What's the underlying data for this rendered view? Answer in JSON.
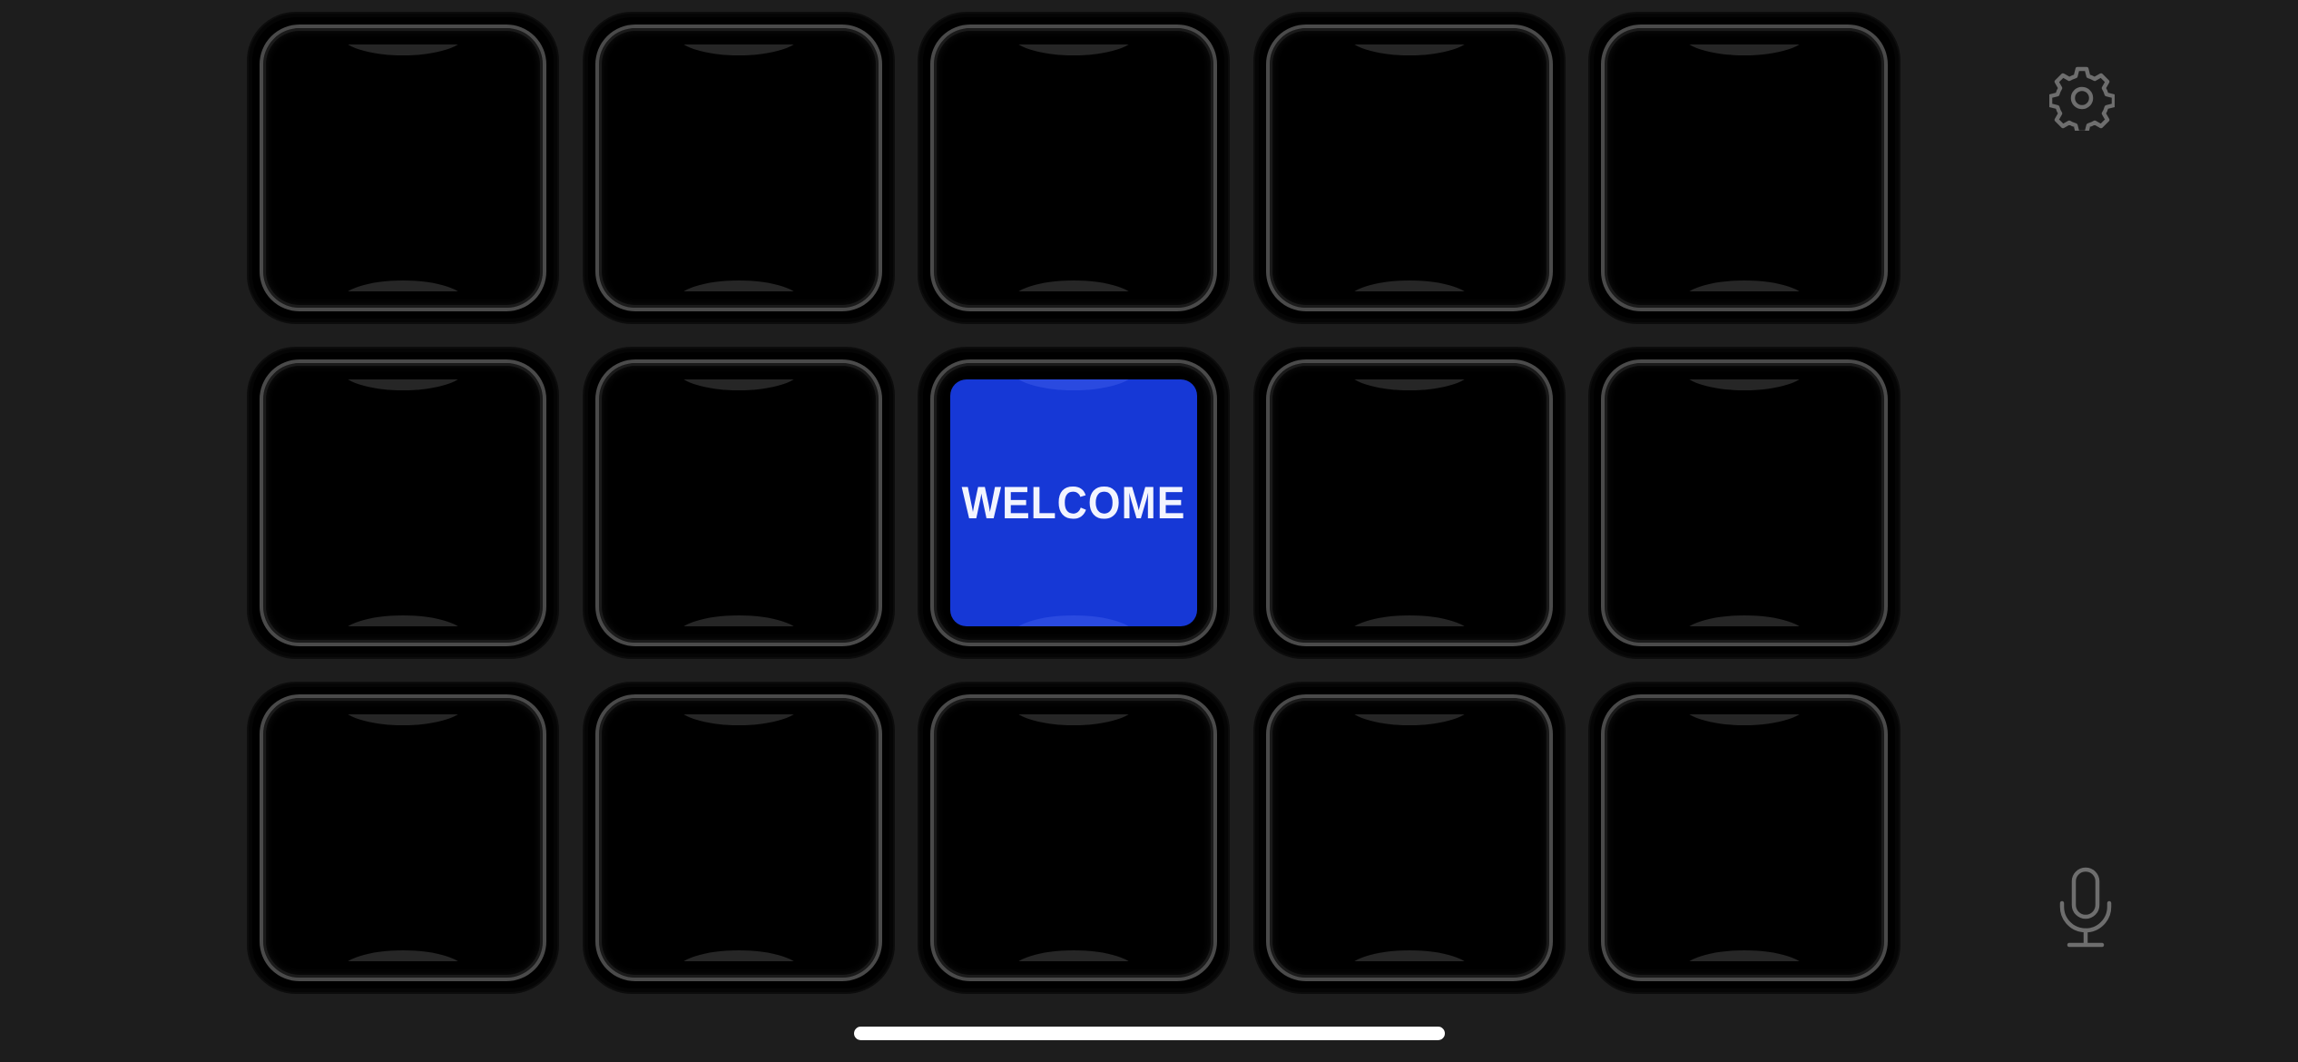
{
  "app": {
    "background_color": "#1d1d1d"
  },
  "deck": {
    "columns": 5,
    "rows": 3,
    "keys": [
      {
        "label": ""
      },
      {
        "label": ""
      },
      {
        "label": ""
      },
      {
        "label": ""
      },
      {
        "label": ""
      },
      {
        "label": ""
      },
      {
        "label": ""
      },
      {
        "label": "WELCOME",
        "color": "#1638d6"
      },
      {
        "label": ""
      },
      {
        "label": ""
      },
      {
        "label": ""
      },
      {
        "label": ""
      },
      {
        "label": ""
      },
      {
        "label": ""
      },
      {
        "label": ""
      }
    ]
  },
  "controls": {
    "settings_icon": "gear-icon",
    "mic_icon": "microphone-icon",
    "icon_color": "#6e6e6e"
  },
  "system": {
    "home_indicator_color": "#ffffff"
  }
}
